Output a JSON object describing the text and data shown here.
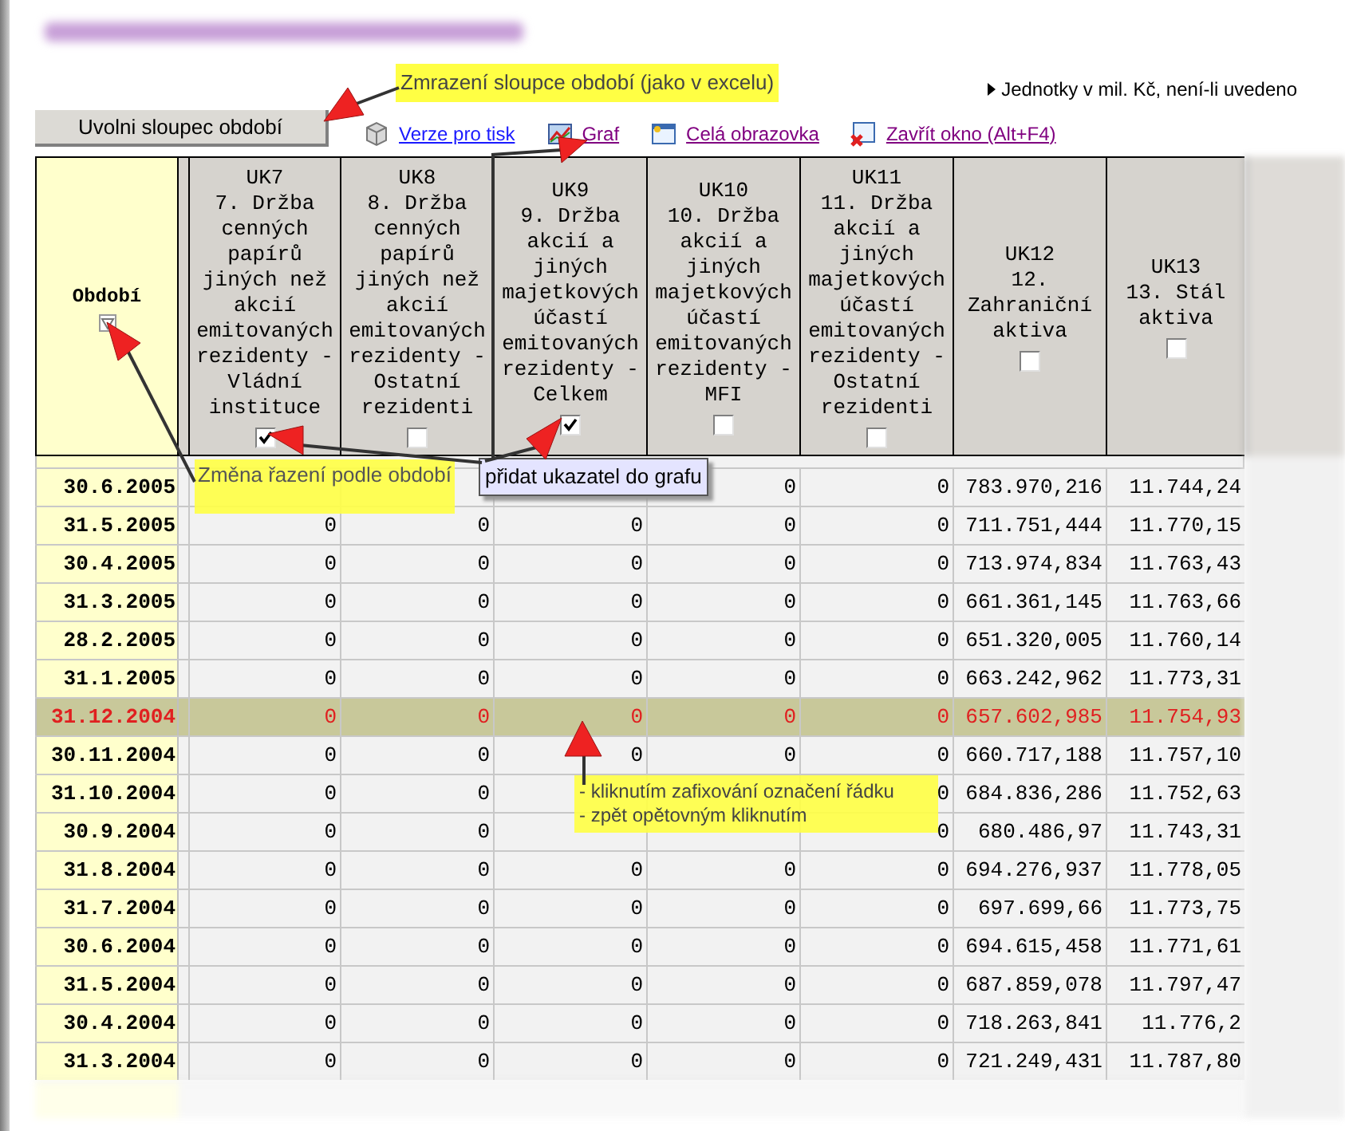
{
  "freeze_button": "Uvolni sloupec období",
  "units_note": "Jednotky v mil. Kč, není-li uvedeno",
  "toolbar_links": [
    {
      "kind": "print",
      "label": "Verze pro tisk",
      "visited": false
    },
    {
      "kind": "chart",
      "label": "Graf",
      "visited": true
    },
    {
      "kind": "fullscreen",
      "label": "Celá obrazovka",
      "visited": true
    },
    {
      "kind": "close",
      "label": "Zavřít okno (Alt+F4)",
      "visited": true
    }
  ],
  "table": {
    "period_column": "Období",
    "columns": [
      {
        "code": "UK7",
        "title": "7. Držba cenných papírů jiných než akcií emitovaných rezidenty - Vládní instituce",
        "checked": true
      },
      {
        "code": "UK8",
        "title": "8. Držba cenných papírů jiných než akcií emitovaných rezidenty - Ostatní rezidenti",
        "checked": false
      },
      {
        "code": "UK9",
        "title": "9. Držba akcií a jiných majetkových účastí emitovaných rezidenty - Celkem",
        "checked": true
      },
      {
        "code": "UK10",
        "title": "10. Držba akcií a jiných majetkových účastí emitovaných rezidenty - MFI",
        "checked": false
      },
      {
        "code": "UK11",
        "title": "11. Držba akcií a jiných majetkových účastí emitovaných rezidenty - Ostatní rezidenti",
        "checked": false
      },
      {
        "code": "UK12",
        "title": "12. Zahraniční aktiva",
        "checked": false
      },
      {
        "code": "UK13",
        "title": "13. Stál aktiva",
        "checked": false
      }
    ],
    "rows": [
      {
        "period": "30.6.2005",
        "selected": false,
        "cells": [
          null,
          null,
          null,
          "0",
          "0",
          "783.970,216",
          "11.744,24"
        ]
      },
      {
        "period": "31.5.2005",
        "selected": false,
        "cells": [
          "0",
          "0",
          "0",
          "0",
          "0",
          "711.751,444",
          "11.770,15"
        ]
      },
      {
        "period": "30.4.2005",
        "selected": false,
        "cells": [
          "0",
          "0",
          "0",
          "0",
          "0",
          "713.974,834",
          "11.763,43"
        ]
      },
      {
        "period": "31.3.2005",
        "selected": false,
        "cells": [
          "0",
          "0",
          "0",
          "0",
          "0",
          "661.361,145",
          "11.763,66"
        ]
      },
      {
        "period": "28.2.2005",
        "selected": false,
        "cells": [
          "0",
          "0",
          "0",
          "0",
          "0",
          "651.320,005",
          "11.760,14"
        ]
      },
      {
        "period": "31.1.2005",
        "selected": false,
        "cells": [
          "0",
          "0",
          "0",
          "0",
          "0",
          "663.242,962",
          "11.773,31"
        ]
      },
      {
        "period": "31.12.2004",
        "selected": true,
        "cells": [
          "0",
          "0",
          "0",
          "0",
          "0",
          "657.602,985",
          "11.754,93"
        ]
      },
      {
        "period": "30.11.2004",
        "selected": false,
        "cells": [
          "0",
          "0",
          "0",
          "0",
          "0",
          "660.717,188",
          "11.757,10"
        ]
      },
      {
        "period": "31.10.2004",
        "selected": false,
        "cells": [
          "0",
          "0",
          null,
          null,
          "0",
          "684.836,286",
          "11.752,63"
        ]
      },
      {
        "period": "30.9.2004",
        "selected": false,
        "cells": [
          "0",
          "0",
          null,
          null,
          "0",
          "680.486,97",
          "11.743,31"
        ]
      },
      {
        "period": "31.8.2004",
        "selected": false,
        "cells": [
          "0",
          "0",
          "0",
          "0",
          "0",
          "694.276,937",
          "11.778,05"
        ]
      },
      {
        "period": "31.7.2004",
        "selected": false,
        "cells": [
          "0",
          "0",
          "0",
          "0",
          "0",
          "697.699,66",
          "11.773,75"
        ]
      },
      {
        "period": "30.6.2004",
        "selected": false,
        "cells": [
          "0",
          "0",
          "0",
          "0",
          "0",
          "694.615,458",
          "11.771,61"
        ]
      },
      {
        "period": "31.5.2004",
        "selected": false,
        "cells": [
          "0",
          "0",
          "0",
          "0",
          "0",
          "687.859,078",
          "11.797,47"
        ]
      },
      {
        "period": "30.4.2004",
        "selected": false,
        "cells": [
          "0",
          "0",
          "0",
          "0",
          "0",
          "718.263,841",
          "11.776,2"
        ]
      },
      {
        "period": "31.3.2004",
        "selected": false,
        "cells": [
          "0",
          "0",
          "0",
          "0",
          "0",
          "721.249,431",
          "11.787,80"
        ]
      }
    ]
  },
  "callouts": {
    "freeze": "Zmrazení sloupce období (jako v excelu)",
    "sort": "Změna řazení podle období",
    "chart": "přidat ukazatel do grafu",
    "row_lines": [
      "- kliknutím zafixování označení řádku",
      "- zpět opětovným kliknutím"
    ]
  }
}
